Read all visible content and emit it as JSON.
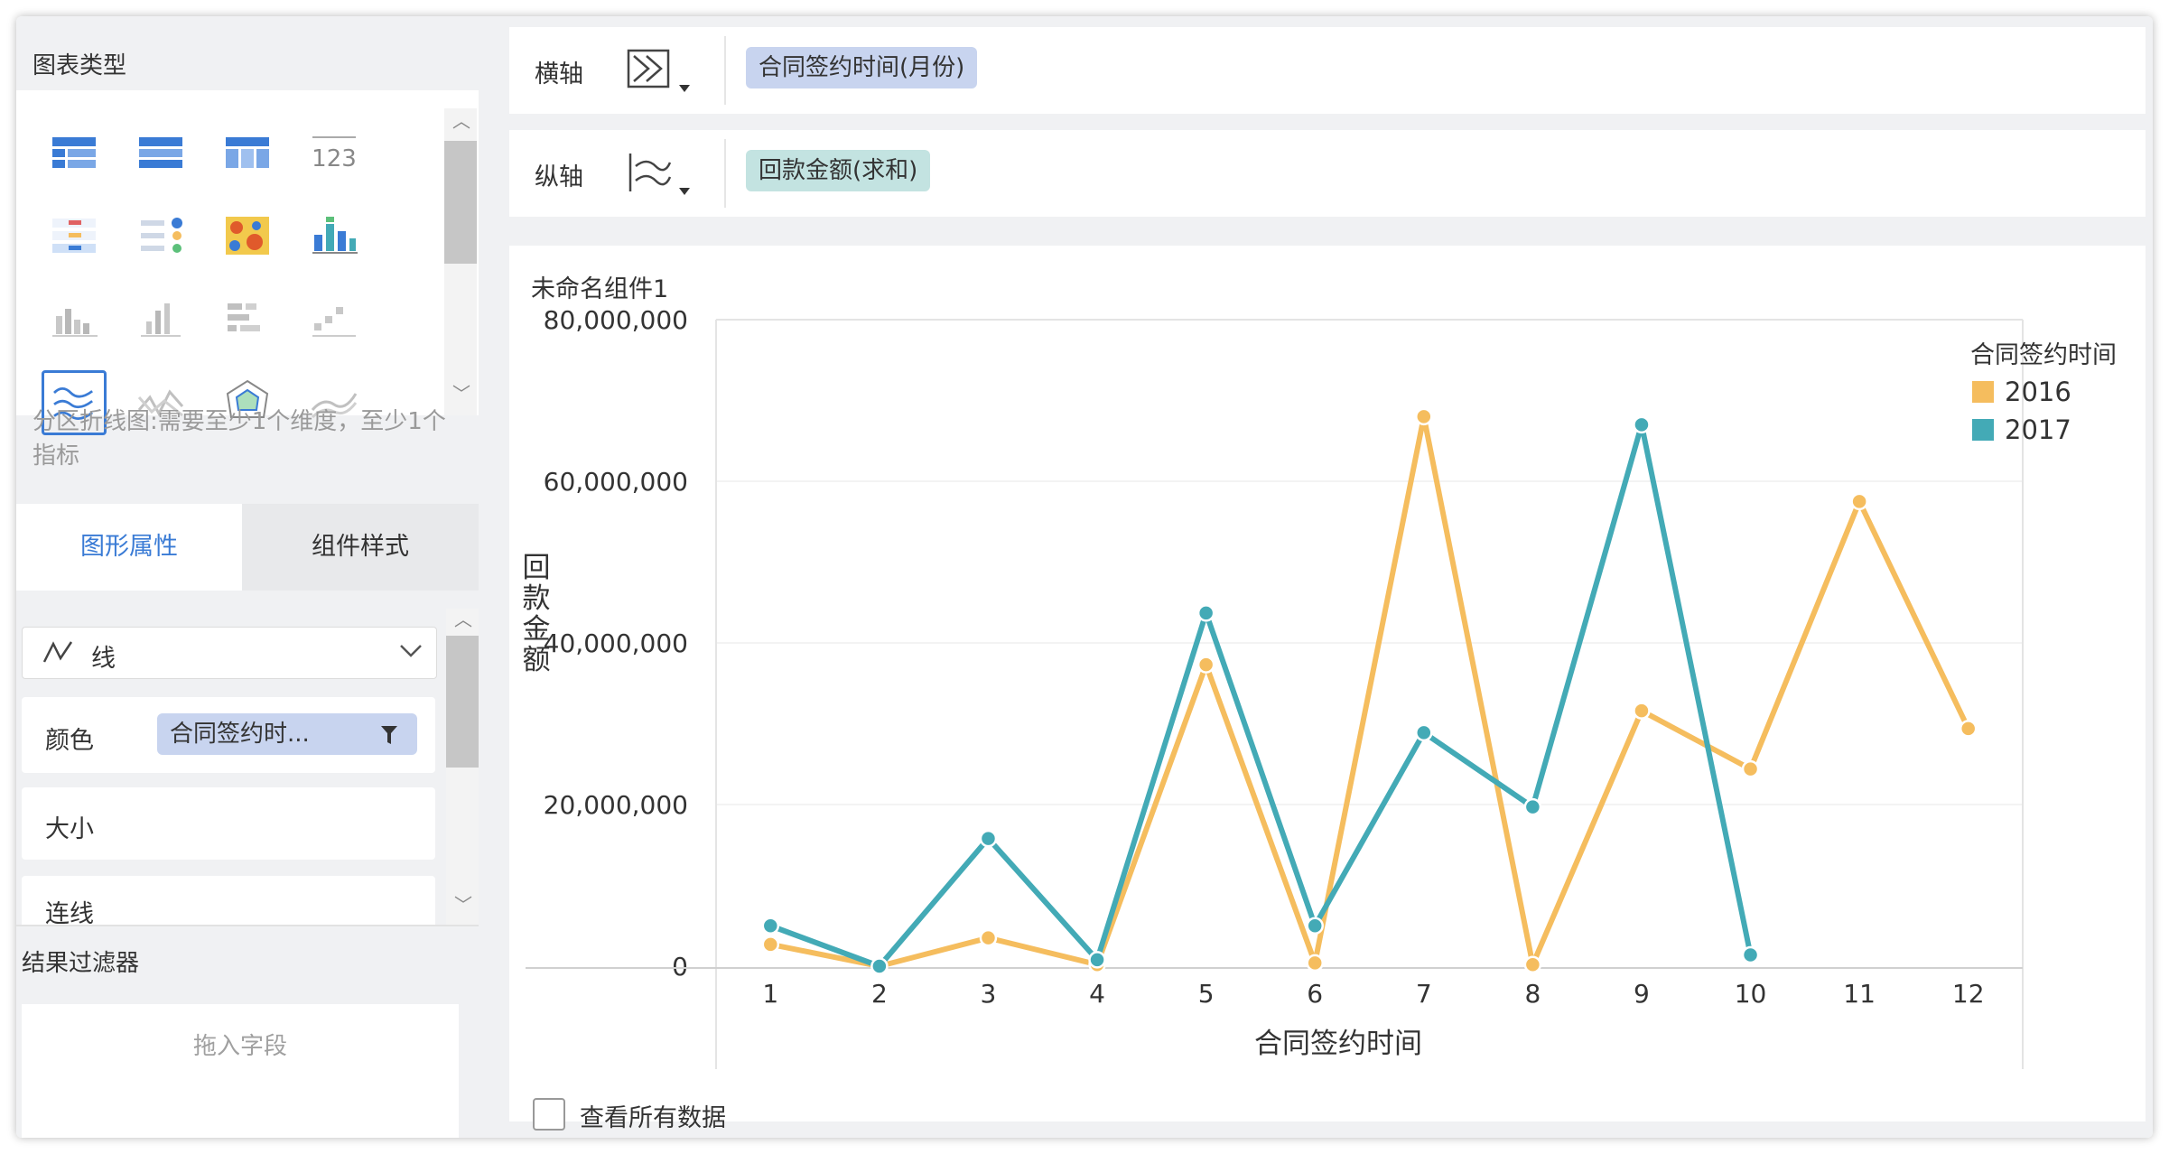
{
  "left_panel": {
    "chart_type_title": "图表类型",
    "chart_types": [
      {
        "name": "detail-table-icon"
      },
      {
        "name": "group-table-icon"
      },
      {
        "name": "cross-table-icon"
      },
      {
        "name": "kpi-number-icon",
        "text": "123"
      },
      {
        "name": "kpi-list-icon"
      },
      {
        "name": "dot-list-icon"
      },
      {
        "name": "heatmap-icon"
      },
      {
        "name": "stacked-bar-icon"
      },
      {
        "name": "bar-chart-icon"
      },
      {
        "name": "column-chart-icon"
      },
      {
        "name": "h-bar-icon"
      },
      {
        "name": "step-chart-icon"
      },
      {
        "name": "area-line-icon",
        "selected": true
      },
      {
        "name": "line-chart-icon"
      },
      {
        "name": "radar-chart-icon"
      },
      {
        "name": "wave-line-icon"
      }
    ],
    "hint": "分区折线图:需要至少1个维度，至少1个指标",
    "tabs": {
      "graphic": "图形属性",
      "style": "组件样式"
    },
    "mark_type": "线",
    "color_label": "颜色",
    "color_field": "合同签约时...",
    "size_label": "大小",
    "connect_label": "连线",
    "filter_title": "结果过滤器",
    "filter_placeholder": "拖入字段"
  },
  "axes": {
    "x_label": "横轴",
    "x_field": "合同签约时间(月份)",
    "y_label": "纵轴",
    "y_field": "回款金额(求和)"
  },
  "chart": {
    "name": "未命名组件1",
    "view_all": "查看所有数据"
  },
  "colors": {
    "s2016": "#f5bd5e",
    "s2017": "#43aab6",
    "x_pill": "#c8d4ef",
    "y_pill": "#c3e3e1",
    "accent": "#3a7bd5"
  },
  "chart_data": {
    "type": "line",
    "xlabel": "合同签约时间",
    "ylabel": "回款金额",
    "categories": [
      "1",
      "2",
      "3",
      "4",
      "5",
      "6",
      "7",
      "8",
      "9",
      "10",
      "11",
      "12"
    ],
    "ylim": [
      0,
      80000000
    ],
    "yticks": [
      0,
      20000000,
      40000000,
      60000000,
      80000000
    ],
    "ytick_labels": [
      "0",
      "20,000,000",
      "40,000,000",
      "60,000,000",
      "80,000,000"
    ],
    "legend_title": "合同签约时间",
    "legend_position": "right",
    "grid": true,
    "series": [
      {
        "name": "2016",
        "values": [
          2700000,
          0,
          3500000,
          200000,
          37300000,
          400000,
          68000000,
          200000,
          31600000,
          24400000,
          57500000,
          29400000
        ]
      },
      {
        "name": "2017",
        "values": [
          5000000,
          0,
          15800000,
          800000,
          43700000,
          5000000,
          28900000,
          19700000,
          67000000,
          1400000,
          null,
          null
        ]
      }
    ]
  }
}
